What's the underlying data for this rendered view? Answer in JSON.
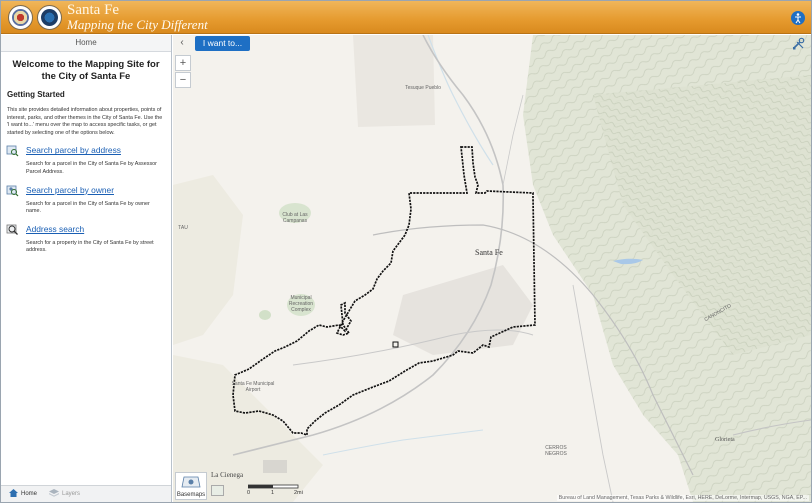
{
  "header": {
    "city_name": "Santa Fe",
    "tagline": "Mapping the City Different"
  },
  "panel": {
    "tab_label": "Home",
    "welcome_title": "Welcome to the Mapping Site for the City of Santa Fe",
    "getting_started": "Getting Started",
    "intro": "This site provides detailed information about properties, points of interest, parks, and other themes in the City of Santa Fe. Use the 'I want to...' menu over the map to access specific tasks, or get started by selecting one of the options below.",
    "tasks": [
      {
        "label": "Search parcel by address",
        "desc": "Search for a parcel in the City of Santa Fe by Assessor Parcel Address.",
        "icon": "search-address-icon"
      },
      {
        "label": "Search parcel by owner",
        "desc": "Search for a parcel in the City of Santa Fe by owner name.",
        "icon": "search-owner-icon"
      },
      {
        "label": "Address search",
        "desc": "Search for a property in the City of Santa Fe by street address.",
        "icon": "address-search-icon"
      }
    ],
    "footer": {
      "home_label": "Home",
      "layers_label": "Layers"
    }
  },
  "map": {
    "iwant_label": "I want to...",
    "zoom_in": "+",
    "zoom_out": "−",
    "collapse": "‹",
    "basemaps_label": "Basemaps",
    "scale": {
      "start": "0",
      "mid": "1",
      "end": "2mi"
    },
    "attribution": "Bureau of Land Management, Texas Parks & Wildlife, Esri, HERE, DeLorme, Intermap, USGS, NGA, EP...",
    "labels": {
      "santa_fe": "Santa Fe",
      "la_cienega": "La Cienega",
      "glorieta": "Glorieta",
      "tesuque": "Tesuque Pueblo",
      "club": "Club at Las Campanas",
      "municipal_rec": "Municipal Recreation Complex",
      "airport": "Santa Fe Municipal Airport",
      "canoncito": "CANONCITO",
      "cerros": "CERROS NEGROS",
      "tau": "TAU"
    },
    "colors": {
      "terrain": "#e7e9dd",
      "boundary": "#111111",
      "water": "#a9c8e8",
      "accent": "#1e6fc4"
    }
  }
}
